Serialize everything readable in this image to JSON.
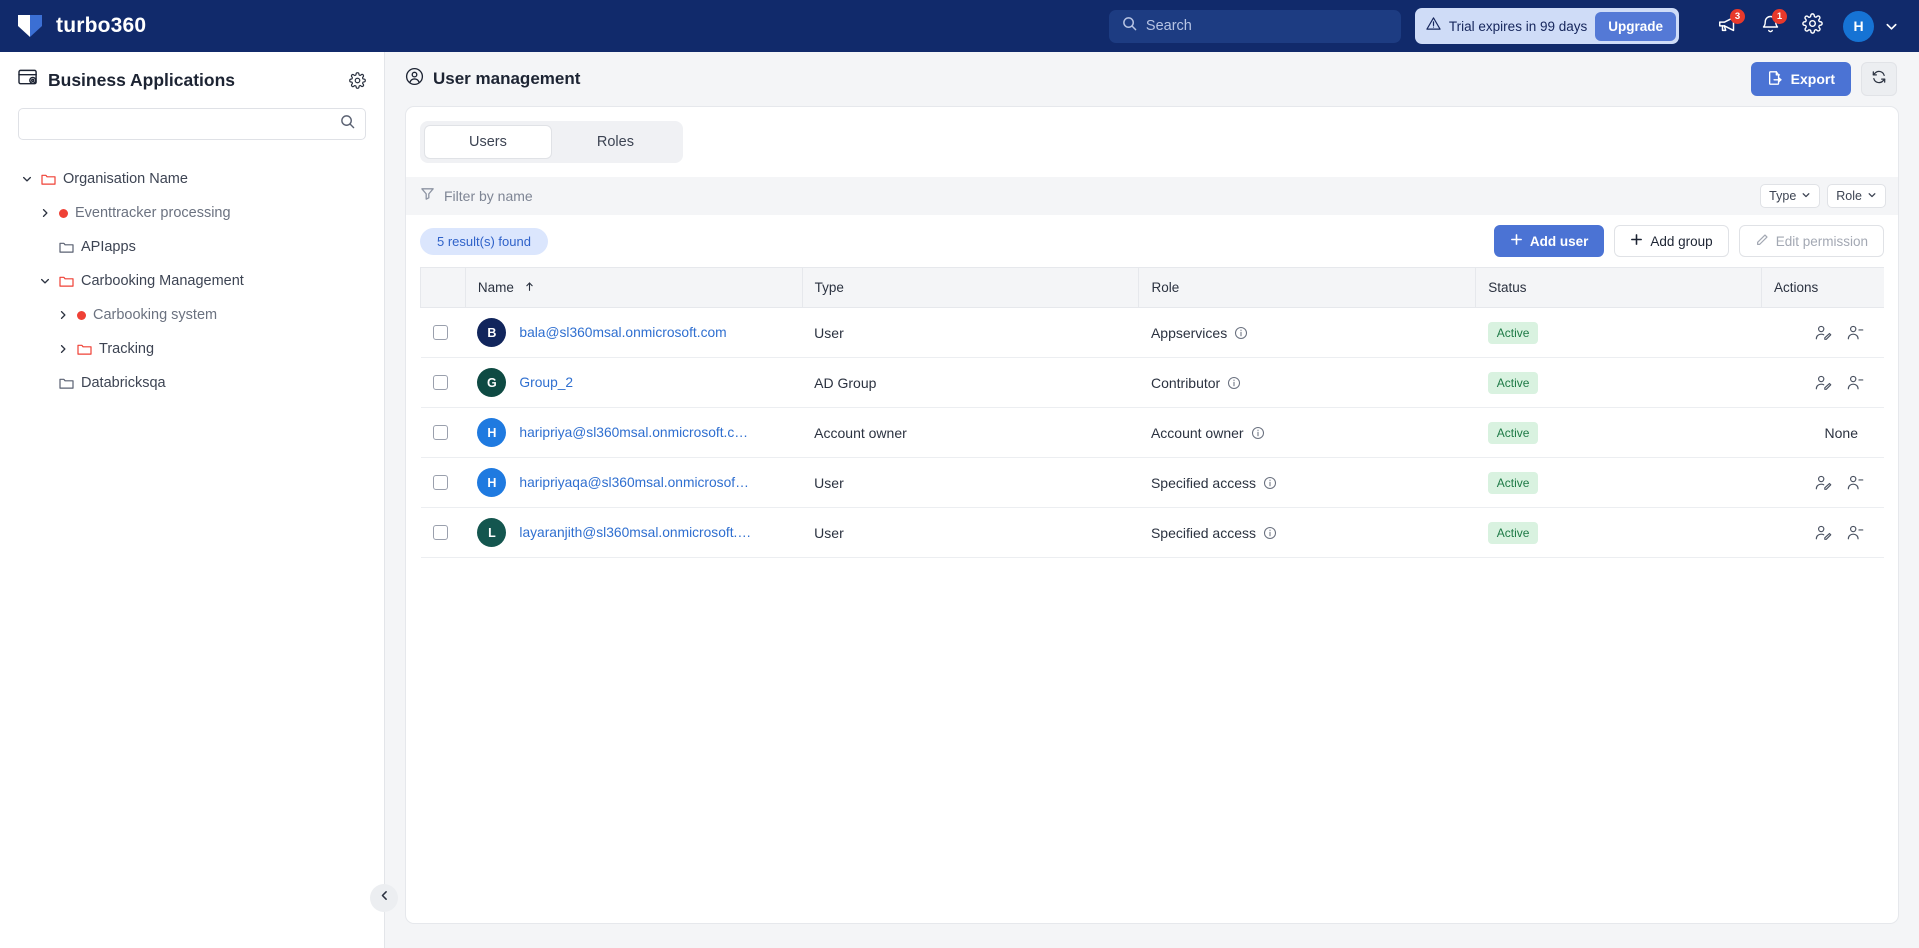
{
  "topbar": {
    "brand_name": "turbo360",
    "search_placeholder": "Search",
    "trial_text": "Trial expires in 99 days",
    "upgrade_label": "Upgrade",
    "announcement_badge": "3",
    "notification_badge": "1",
    "avatar_initial": "H"
  },
  "sidebar": {
    "title": "Business Applications",
    "search_value": "",
    "tree": [
      {
        "label": "Organisation Name",
        "depth": 0,
        "twisty": "down",
        "icon": "folder",
        "muted": false
      },
      {
        "label": "Eventtracker processing",
        "depth": 1,
        "twisty": "right",
        "icon": "dot",
        "muted": true
      },
      {
        "label": "APIapps",
        "depth": 1,
        "twisty": "none",
        "icon": "folder-gray",
        "muted": false
      },
      {
        "label": "Carbooking Management",
        "depth": 1,
        "twisty": "down",
        "icon": "folder",
        "muted": false
      },
      {
        "label": "Carbooking system",
        "depth": 2,
        "twisty": "right",
        "icon": "dot",
        "muted": true
      },
      {
        "label": "Tracking",
        "depth": 2,
        "twisty": "right",
        "icon": "folder",
        "muted": false
      },
      {
        "label": "Databricksqa",
        "depth": 1,
        "twisty": "none",
        "icon": "folder-gray",
        "muted": false
      }
    ]
  },
  "main": {
    "page_title": "User management",
    "export_label": "Export",
    "tabs": [
      {
        "label": "Users",
        "active": true
      },
      {
        "label": "Roles",
        "active": false
      }
    ],
    "filter_placeholder": "Filter by name",
    "type_filter_label": "Type",
    "role_filter_label": "Role",
    "result_count_label": "5 result(s) found",
    "add_user_label": "Add user",
    "add_group_label": "Add group",
    "edit_permission_label": "Edit permission",
    "columns": [
      "Name",
      "Type",
      "Role",
      "Status",
      "Actions"
    ],
    "sort_column": "Name",
    "sort_direction": "asc",
    "rows": [
      {
        "checked": false,
        "initial": "B",
        "avatar_color": "#11255c",
        "name": "bala@sl360msal.onmicrosoft.com",
        "type": "User",
        "role": "Appservices",
        "status": "Active",
        "actions": "icons"
      },
      {
        "checked": false,
        "initial": "G",
        "avatar_color": "#0e4a43",
        "name": "Group_2",
        "type": "AD Group",
        "role": "Contributor",
        "status": "Active",
        "actions": "icons"
      },
      {
        "checked": false,
        "initial": "H",
        "avatar_color": "#1f7ae0",
        "name": "haripriya@sl360msal.onmicrosoft.c…",
        "type": "Account owner",
        "role": "Account owner",
        "status": "Active",
        "actions": "None"
      },
      {
        "checked": false,
        "initial": "H",
        "avatar_color": "#1f7ae0",
        "name": "haripriyaqa@sl360msal.onmicrosof…",
        "type": "User",
        "role": "Specified access",
        "status": "Active",
        "actions": "icons"
      },
      {
        "checked": false,
        "initial": "L",
        "avatar_color": "#14564f",
        "name": "layaranjith@sl360msal.onmicrosoft.…",
        "type": "User",
        "role": "Specified access",
        "status": "Active",
        "actions": "icons"
      }
    ]
  },
  "colors": {
    "brand_navy": "#112a6b",
    "accent_blue": "#4b73d4",
    "link_blue": "#2f6fd0",
    "status_green_bg": "#d9f2e0",
    "status_green_fg": "#1e7a46",
    "alert_red": "#e8392b",
    "folder_orange": "#ef4136"
  }
}
